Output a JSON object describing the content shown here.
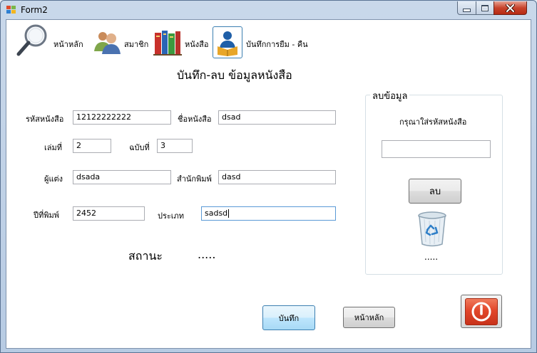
{
  "window": {
    "title": "Form2"
  },
  "toolbar": {
    "items": [
      {
        "label": "หน้าหลัก",
        "icon": "magnifier-icon"
      },
      {
        "label": "สมาชิก",
        "icon": "users-icon"
      },
      {
        "label": "หนังสือ",
        "icon": "books-icon"
      },
      {
        "label": "บันทึกการยืม - คืน",
        "icon": "reader-icon"
      }
    ]
  },
  "form": {
    "heading": "บันทึก-ลบ ข้อมูลหนังสือ",
    "fields": {
      "book_code": {
        "label": "รหัสหนังสือ",
        "value": "12122222222"
      },
      "book_name": {
        "label": "ชื่อหนังสือ",
        "value": "dsad"
      },
      "volume": {
        "label": "เล่มที่",
        "value": "2"
      },
      "copy": {
        "label": "ฉบับที่",
        "value": "3"
      },
      "author": {
        "label": "ผู้แต่ง",
        "value": "dsada"
      },
      "publisher": {
        "label": "สำนักพิมพ์",
        "value": "dasd"
      },
      "year": {
        "label": "ปีที่พิมพ์",
        "value": "2452"
      },
      "category": {
        "label": "ประเภท",
        "value": "sadsd"
      }
    },
    "status": {
      "label": "สถานะ",
      "value": "....."
    },
    "buttons": {
      "save": "บันทึก",
      "home": "หน้าหลัก"
    }
  },
  "delete_panel": {
    "title": "ลบข้อมูล",
    "prompt": "กรุณาใส่รหัสหนังสือ",
    "input_value": "",
    "button": "ลบ",
    "status": "....."
  },
  "colors": {
    "accent": "#3c7fb1",
    "power": "#e2462a",
    "frame": "#b7cbe3"
  }
}
